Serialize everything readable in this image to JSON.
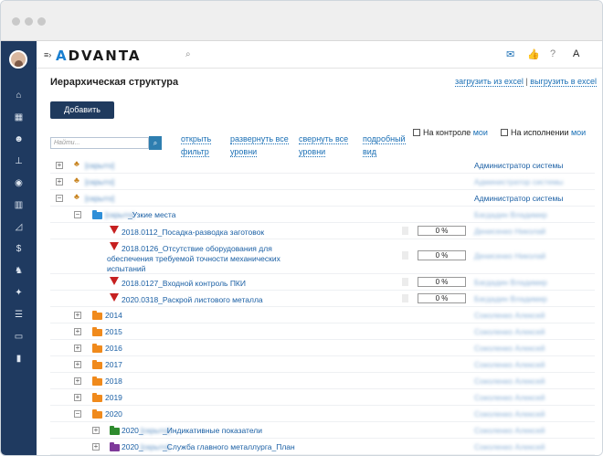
{
  "app": {
    "logo": "ADVANTA",
    "logo_parts": [
      "A",
      "DVANTA"
    ],
    "colors": {
      "sidebar": "#1f3a60",
      "accent": "#1a7fd0",
      "link": "#1a5fa4",
      "button": "#1f3a5e",
      "funnel": "#c62020",
      "folder_orange": "#f08a1c",
      "folder_blue": "#2f8fd8",
      "folder_green": "#2e8b2e",
      "folder_purple": "#7e3a9a"
    }
  },
  "topbar": {
    "icons": [
      "menu-icon",
      "search-icon",
      "mail-icon",
      "thumbs-up-icon",
      "help-icon",
      "font-icon"
    ],
    "help": "?",
    "font": "A"
  },
  "sidebar": {
    "icons": [
      "home-icon",
      "calendar-icon",
      "people-icon",
      "hierarchy-icon",
      "target-icon",
      "chart-icon",
      "graph-icon",
      "dollar-icon",
      "runner-icon",
      "magic-icon",
      "checklist-icon",
      "window-icon",
      "bookmark-icon"
    ],
    "glyphs": [
      "⌂",
      "▦",
      "☻",
      "⊥",
      "◉",
      "▥",
      "◿",
      "$",
      "♞",
      "✦",
      "☰",
      "▭",
      "▮"
    ]
  },
  "page": {
    "title": "Иерархическая структура",
    "upload_excel": "загрузить из excel",
    "separator": "|",
    "download_excel": "выгрузить в excel",
    "add_button": "Добавить",
    "search_placeholder": "Найти...",
    "search_button": "⌕"
  },
  "filters": {
    "open_filter": [
      "открыть",
      "фильтр"
    ],
    "expand_all": [
      "развернуть все",
      "уровни"
    ],
    "collapse_all": [
      "свернуть все",
      "уровни"
    ],
    "detailed_view": [
      "подробный",
      "вид"
    ],
    "on_control": "На контроле",
    "on_control_mine": "мои",
    "on_execution": "На исполнении",
    "on_execution_mine": "мои"
  },
  "rows": [
    {
      "expander": "+",
      "label": "[скрыто]",
      "owner": "Администратор системы",
      "owner_blurred": false,
      "blurred": true
    },
    {
      "expander": "+",
      "label": "[скрыто]",
      "owner": "Администратор системы",
      "owner_blurred": true,
      "blurred": true
    },
    {
      "expander": "−",
      "label": "[скрыто]",
      "owner": "Администратор системы",
      "owner_blurred": false,
      "blurred": true
    },
    {
      "expander": "−",
      "label_prefix": "[скрыто]",
      "label": "_Узкие места",
      "owner": "Багдадин Владимир",
      "owner_blurred": true
    },
    {
      "label": "2018.0112_Посадка-разводка заготовок",
      "pct": "0 %",
      "owner": "Денисенко Николай",
      "owner_blurred": true
    },
    {
      "label_lines": [
        "2018.0126_Отсутствие оборудования для",
        "обеспечения требуемой точности механических",
        "испытаний"
      ],
      "pct": "0 %",
      "owner": "Денисенко Николай",
      "owner_blurred": true
    },
    {
      "label": "2018.0127_Входной контроль ПКИ",
      "pct": "0 %",
      "owner": "Багдадин Владимир",
      "owner_blurred": true
    },
    {
      "label": "2020.0318_Раскрой листового металла",
      "pct": "0 %",
      "owner": "Багдадин Владимир",
      "owner_blurred": true
    },
    {
      "expander": "+",
      "label": "2014",
      "owner": "Соколенко Алексей",
      "owner_blurred": true
    },
    {
      "expander": "+",
      "label": "2015",
      "owner": "Соколенко Алексей",
      "owner_blurred": true
    },
    {
      "expander": "+",
      "label": "2016",
      "owner": "Соколенко Алексей",
      "owner_blurred": true
    },
    {
      "expander": "+",
      "label": "2017",
      "owner": "Соколенко Алексей",
      "owner_blurred": true
    },
    {
      "expander": "+",
      "label": "2018",
      "owner": "Соколенко Алексей",
      "owner_blurred": true
    },
    {
      "expander": "+",
      "label": "2019",
      "owner": "Соколенко Алексей",
      "owner_blurred": true
    },
    {
      "expander": "−",
      "label": "2020",
      "owner": "Соколенко Алексей",
      "owner_blurred": true
    },
    {
      "expander": "+",
      "label_prefix": "2020_",
      "label_mid": "[скрыто]",
      "label": "_Индикативные показатели",
      "owner": "Соколенко Алексей",
      "owner_blurred": true
    },
    {
      "expander": "+",
      "label_prefix": "2020_",
      "label_mid": "[скрыто]",
      "label": "_Служба главного металлурга_План",
      "owner": "Соколенко Алексей",
      "owner_blurred": true
    }
  ]
}
